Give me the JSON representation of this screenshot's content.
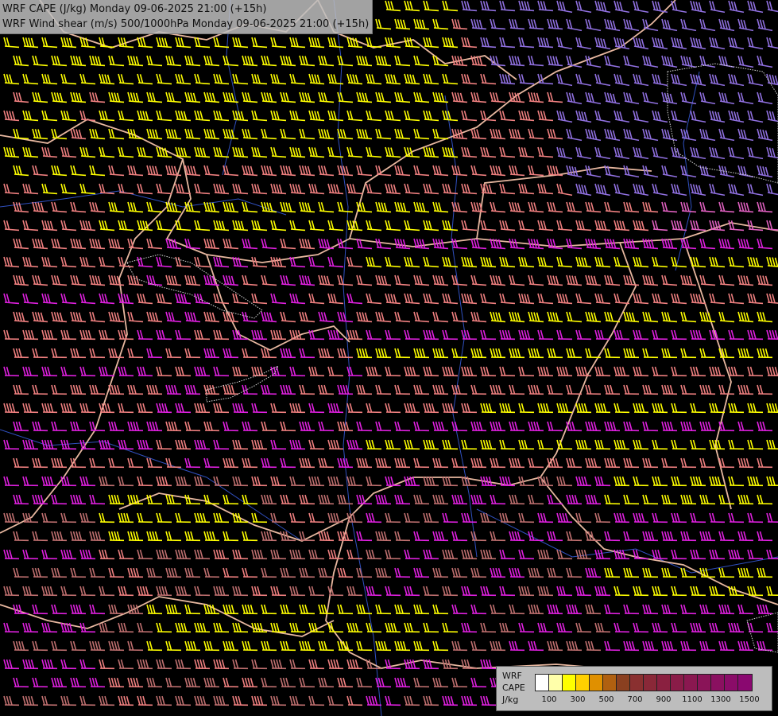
{
  "title": {
    "line1": "WRF CAPE (J/kg) Monday 09-06-2025 21:00 (+15h)",
    "line2": "WRF Wind shear (m/s) 500/1000hPa Monday 09-06-2025 21:00 (+15h)"
  },
  "legend": {
    "model": "WRF",
    "field": "CAPE",
    "unit": "J/kg",
    "ticks": [
      "100",
      "300",
      "500",
      "700",
      "900",
      "1100",
      "1300",
      "1500"
    ],
    "colors": [
      "#ffffff",
      "#ffffaa",
      "#ffff00",
      "#ffd000",
      "#e09000",
      "#b06010",
      "#8a4020",
      "#8a3030",
      "#8a2838",
      "#8a2040",
      "#8a1c48",
      "#8a1850",
      "#8a1458",
      "#8a1060",
      "#8a0c68",
      "#8a0870"
    ]
  },
  "map": {
    "background": "#000000",
    "border_color": "#e8b8a0",
    "river_color": "#3050c0",
    "barb_colors": {
      "yellow": "#ffff00",
      "salmon": "#f08080",
      "magenta": "#e020e0",
      "rose": "#c07070",
      "purple": "#9070e0",
      "pink": "#e060c0"
    }
  }
}
